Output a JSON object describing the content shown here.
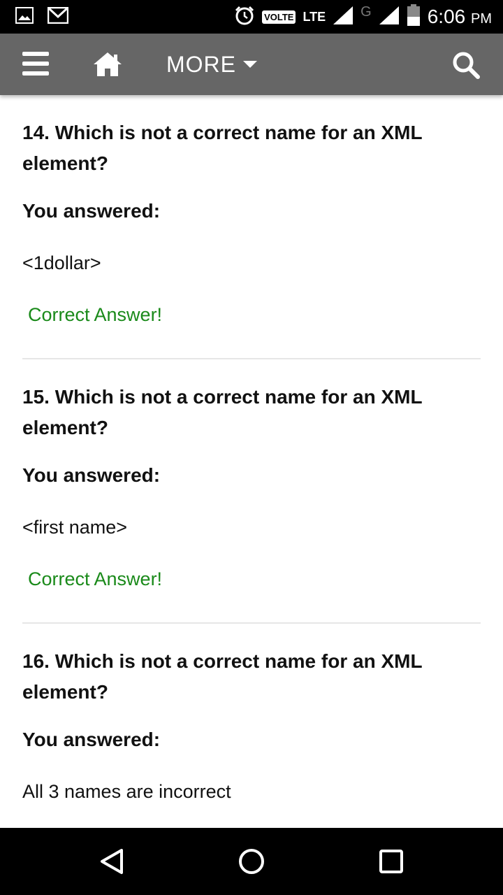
{
  "status_bar": {
    "time": "6:06",
    "ampm": "PM",
    "volte": "VOLTE",
    "lte": "LTE",
    "g_label": "G",
    "icons": [
      "gallery-notification-icon",
      "gmail-icon",
      "alarm-icon",
      "signal-icon",
      "battery-icon"
    ]
  },
  "app_bar": {
    "more_label": "MORE",
    "icons": [
      "hamburger-menu-icon",
      "home-icon",
      "caret-down-icon",
      "search-icon"
    ]
  },
  "questions": [
    {
      "text": "14. Which is not a correct name for an XML element?",
      "answered_label": "You answered:",
      "answer": "<1dollar>",
      "result": "Correct Answer!"
    },
    {
      "text": "15. Which is not a correct name for an XML element?",
      "answered_label": "You answered:",
      "answer": "<first name>",
      "result": "Correct Answer!"
    },
    {
      "text": "16. Which is not a correct name for an XML element?",
      "answered_label": "You answered:",
      "answer": "All 3 names are incorrect"
    }
  ],
  "nav_bar": {
    "icons": [
      "back-icon",
      "home-circle-icon",
      "recents-icon"
    ]
  },
  "colors": {
    "app_bar": "#666666",
    "correct": "#1a8a1a",
    "divider": "#e6e6e6"
  }
}
